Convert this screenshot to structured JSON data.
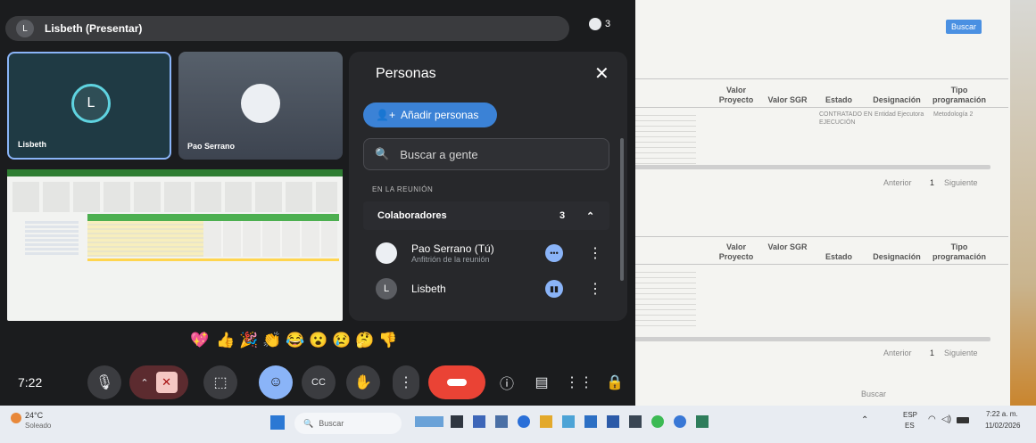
{
  "meeting": {
    "presenter_title": "Lisbeth (Presentar)",
    "presenter_initial": "L",
    "participant_count": "3",
    "tiles": [
      {
        "name": "Lisbeth",
        "initial": "L"
      },
      {
        "name": "Pao Serrano"
      }
    ],
    "time": "7:22",
    "reactions": [
      "💖",
      "👍",
      "🎉",
      "👏",
      "😂",
      "😮",
      "😢",
      "🤔",
      "👎"
    ]
  },
  "people_panel": {
    "title": "Personas",
    "add_button": "Añadir personas",
    "search_placeholder": "Buscar a gente",
    "section_label": "EN LA REUNIÓN",
    "group_label": "Colaboradores",
    "group_count": "3",
    "participants": [
      {
        "name": "Pao Serrano (Tú)",
        "role": "Anfitrión de la reunión"
      },
      {
        "name": "Lisbeth",
        "initial": "L"
      }
    ]
  },
  "background_doc": {
    "search_button": "Buscar",
    "table1": {
      "headers": [
        "Valor Proyecto",
        "Valor SGR",
        "Estado",
        "Designación",
        "Tipo programación"
      ],
      "row_status": "CONTRATADO EN EJECUCIÓN",
      "row_designation": "Entidad Ejecutora",
      "row_type": "Metodología 2"
    },
    "pager": {
      "prev": "Anterior",
      "page": "1",
      "next": "Siguiente"
    },
    "table2": {
      "headers": [
        "Valor Proyecto",
        "Valor SGR",
        "Estado",
        "Designación",
        "Tipo programación"
      ]
    },
    "search_label": "Buscar"
  },
  "taskbar": {
    "weather_temp": "24°C",
    "weather_desc": "Soleado",
    "search_placeholder": "Buscar",
    "lang": "ESP",
    "lang2": "ES",
    "clock_time": "7:22 a. m.",
    "clock_date": "11/02/2026"
  },
  "colors": {
    "accent": "#3b82d6",
    "end_call": "#ea4335",
    "tile_border": "#8ab4f8"
  }
}
